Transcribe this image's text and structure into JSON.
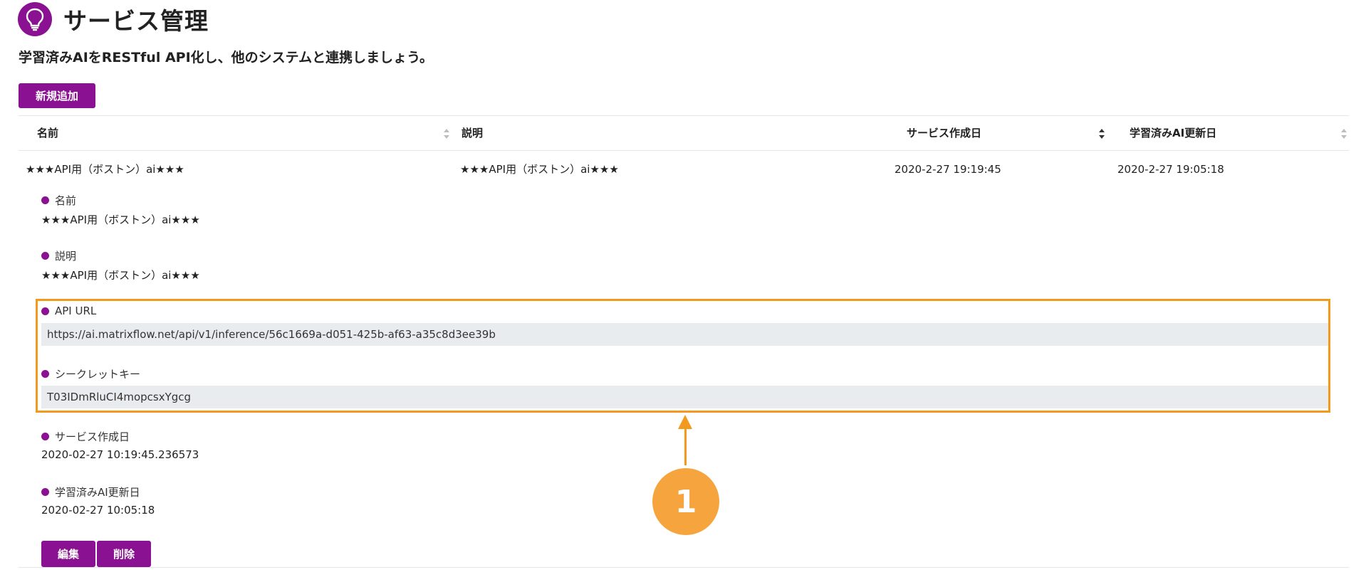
{
  "header": {
    "title": "サービス管理",
    "subtitle": "学習済みAIをRESTful API化し、他のシステムと連携しましょう。",
    "logo_icon": "lightbulb-icon"
  },
  "toolbar": {
    "add_label": "新規追加"
  },
  "table": {
    "columns": [
      "名前",
      "説明",
      "サービス作成日",
      "学習済みAI更新日"
    ],
    "rows": [
      {
        "name": "★★★API用（ボストン）ai★★★",
        "description": "★★★API用（ボストン）ai★★★",
        "created": "2020-2-27 19:19:45",
        "updated": "2020-2-27 19:05:18"
      }
    ]
  },
  "detail": {
    "name_label": "名前",
    "name_value": "★★★API用（ボストン）ai★★★",
    "desc_label": "説明",
    "desc_value": "★★★API用（ボストン）ai★★★",
    "api_url_label": "API URL",
    "api_url_value": "https://ai.matrixflow.net/api/v1/inference/56c1669a-d051-425b-af63-a35c8d3ee39b",
    "secret_label": "シークレットキー",
    "secret_value": "T03IDmRluCI4mopcsxYgcg",
    "created_label": "サービス作成日",
    "created_value": "2020-02-27 10:19:45.236573",
    "updated_label": "学習済みAI更新日",
    "updated_value": "2020-02-27 10:05:18"
  },
  "actions": {
    "edit_label": "編集",
    "delete_label": "削除"
  },
  "annotation": {
    "callout_number": "1"
  },
  "colors": {
    "brand": "#8a1191",
    "highlight": "#f39a1e",
    "callout": "#f6a53e",
    "field_bg": "#e9ecee"
  }
}
